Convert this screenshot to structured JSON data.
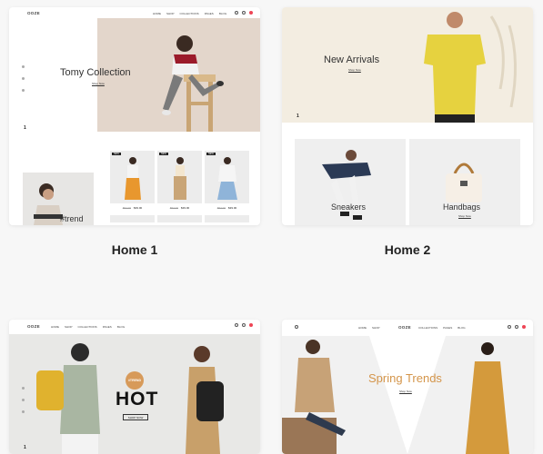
{
  "home1": {
    "caption": "Home 1",
    "logo": "OOZE",
    "nav": [
      "HOME",
      "SHOP",
      "COLLECTIONS",
      "PAGES",
      "BLOG"
    ],
    "hero_title": "Tomy Collection",
    "hero_link": "Shop Now",
    "slide_counter": "1",
    "trend_label": "#trend",
    "products": [
      {
        "badge": "NEW",
        "price_old": "$54.00",
        "price": "$39.00"
      },
      {
        "badge": "NEW",
        "price_old": "$54.00",
        "price": "$39.00"
      },
      {
        "badge": "NEW",
        "price_old": "$54.00",
        "price": "$39.00"
      }
    ]
  },
  "home2": {
    "caption": "Home 2",
    "hero_title": "New Arrivals",
    "hero_link": "Shop Now",
    "slide_counter": "1",
    "tile1_label": "Sneakers",
    "tile2_label": "Handbags",
    "tile2_link": "Shop Now"
  },
  "home3": {
    "logo": "OOZE",
    "nav": [
      "HOME",
      "SHOP",
      "COLLECTIONS",
      "PAGES",
      "BLOG"
    ],
    "tag": "#TREND",
    "hero_title": "HOT",
    "hero_button": "SHOP NOW",
    "slide_counter": "1"
  },
  "home4": {
    "logo": "OOZE",
    "nav": [
      "HOME",
      "SHOP",
      "COLLECTIONS",
      "PAGES",
      "BLOG"
    ],
    "hero_title": "Spring Trends",
    "hero_link": "Shop Now",
    "accent": "#d4954a"
  }
}
